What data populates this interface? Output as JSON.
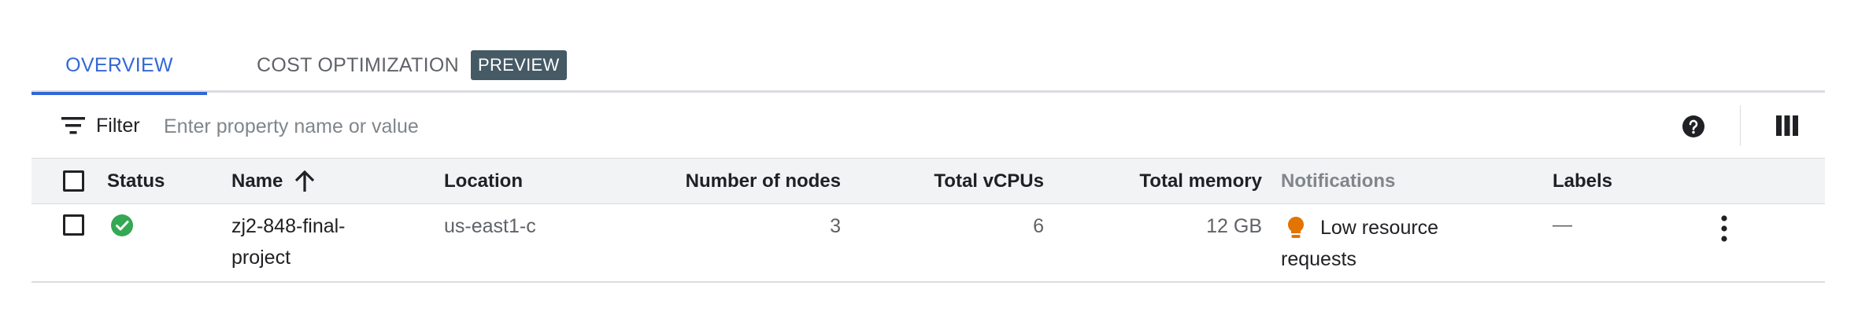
{
  "tabs": [
    {
      "label": "OVERVIEW",
      "active": true
    },
    {
      "label": "COST OPTIMIZATION",
      "badge": "PREVIEW",
      "active": false
    }
  ],
  "filter": {
    "label": "Filter",
    "placeholder": "Enter property name or value"
  },
  "icons": {
    "filter": "filter-list-icon",
    "help": "help-icon",
    "columns": "column-display-icon",
    "status_ok": "check-circle-icon",
    "notification": "lightbulb-icon",
    "row_menu": "more-vert-icon",
    "sort": "arrow-up-icon"
  },
  "colors": {
    "accent": "#3367d6",
    "badge_bg": "#455a64",
    "status_ok": "#34a853",
    "notification": "#e37400",
    "header_bg": "#f1f3f4"
  },
  "table": {
    "columns": {
      "status": "Status",
      "name": "Name",
      "location": "Location",
      "nodes": "Number of nodes",
      "vcpus": "Total vCPUs",
      "memory": "Total memory",
      "notifications": "Notifications",
      "labels": "Labels"
    },
    "sort": {
      "column": "name",
      "direction": "ascending"
    },
    "rows": [
      {
        "status": "ok",
        "name": "zj2-848-final-project",
        "name_line1": "zj2-848-final-",
        "name_line2": "project",
        "location": "us-east1-c",
        "nodes": "3",
        "vcpus": "6",
        "memory": "12 GB",
        "notification": "Low resource requests",
        "notification_line1": "Low resource",
        "notification_line2": "requests",
        "labels": "—"
      }
    ]
  }
}
